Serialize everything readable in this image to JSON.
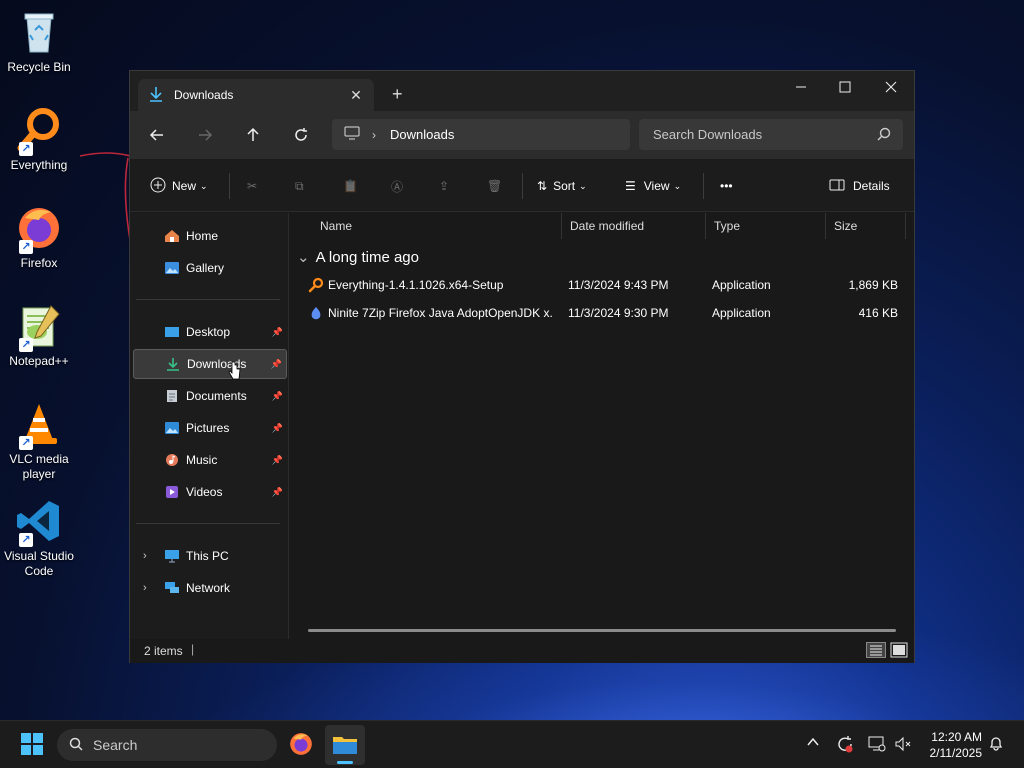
{
  "desktop": {
    "icons": [
      {
        "label": "Recycle Bin",
        "icon": "recycle-bin-icon"
      },
      {
        "label": "Everything",
        "icon": "everything-icon"
      },
      {
        "label": "Firefox",
        "icon": "firefox-icon"
      },
      {
        "label": "Notepad++",
        "icon": "notepad-plus-plus-icon"
      },
      {
        "label": "VLC media player",
        "icon": "vlc-icon"
      },
      {
        "label": "Visual Studio Code",
        "icon": "vscode-icon"
      }
    ]
  },
  "window": {
    "tab_title": "Downloads",
    "new_tab_glyph": "+",
    "breadcrumb": "Downloads",
    "search_placeholder": "Search Downloads",
    "accent": "#4cc2ff"
  },
  "toolbar": {
    "new_label": "New",
    "sort_label": "Sort",
    "view_label": "View",
    "more_glyph": "•••",
    "details_label": "Details"
  },
  "sidebar": {
    "top": [
      {
        "label": "Home",
        "icon": "home-icon"
      },
      {
        "label": "Gallery",
        "icon": "gallery-icon"
      }
    ],
    "pinned": [
      {
        "label": "Desktop",
        "icon": "desktop-folder-icon"
      },
      {
        "label": "Downloads",
        "icon": "downloads-folder-icon",
        "selected": true
      },
      {
        "label": "Documents",
        "icon": "documents-folder-icon"
      },
      {
        "label": "Pictures",
        "icon": "pictures-folder-icon"
      },
      {
        "label": "Music",
        "icon": "music-folder-icon"
      },
      {
        "label": "Videos",
        "icon": "videos-folder-icon"
      }
    ],
    "bottom": [
      {
        "label": "This PC",
        "icon": "this-pc-icon"
      },
      {
        "label": "Network",
        "icon": "network-icon"
      }
    ]
  },
  "files": {
    "columns": [
      "Name",
      "Date modified",
      "Type",
      "Size"
    ],
    "group_label": "A long time ago",
    "rows": [
      {
        "name": "Everything-1.4.1.1026.x64-Setup",
        "date": "11/3/2024 9:43 PM",
        "type": "Application",
        "size": "1,869 KB",
        "icon": "everything-setup-icon"
      },
      {
        "name": "Ninite 7Zip Firefox Java AdoptOpenJDK x...",
        "date": "11/3/2024 9:30 PM",
        "type": "Application",
        "size": "416 KB",
        "icon": "ninite-icon"
      }
    ]
  },
  "status": {
    "item_count": "2 items"
  },
  "taskbar": {
    "search_label": "Search",
    "time": "12:20 AM",
    "date": "2/11/2025"
  }
}
